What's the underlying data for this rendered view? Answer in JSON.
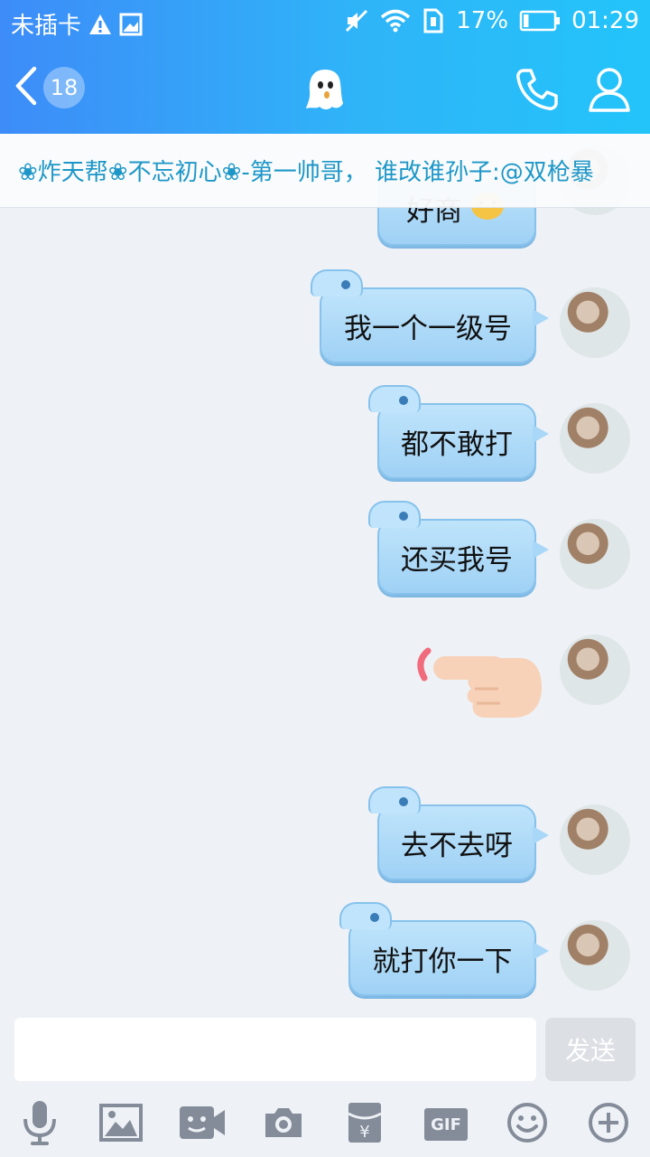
{
  "status_bar": {
    "carrier": "未插卡",
    "battery_percent": "17%",
    "time": "01:29",
    "battery_level": 0.17
  },
  "title_bar": {
    "unread_count": "18"
  },
  "banner": {
    "text": "❀炸天帮❀不忘初心❀-第一帅哥， 谁改谁孙子:@双枪暴"
  },
  "messages": [
    {
      "text": "好商"
    },
    {
      "text": "我一个一级号"
    },
    {
      "text": "都不敢打"
    },
    {
      "text": "还买我号"
    },
    {
      "text": ""
    },
    {
      "text": "去不去呀"
    },
    {
      "text": "就打你一下"
    }
  ],
  "input": {
    "value": "",
    "send_label": "发送"
  },
  "toolbar": {
    "gif_label": "GIF",
    "redpacket_symbol": "¥"
  },
  "colors": {
    "header_start": "#3d8cf8",
    "header_end": "#23c4fa",
    "bubble": "#a9d7f7",
    "banner_text": "#1e97c8"
  }
}
